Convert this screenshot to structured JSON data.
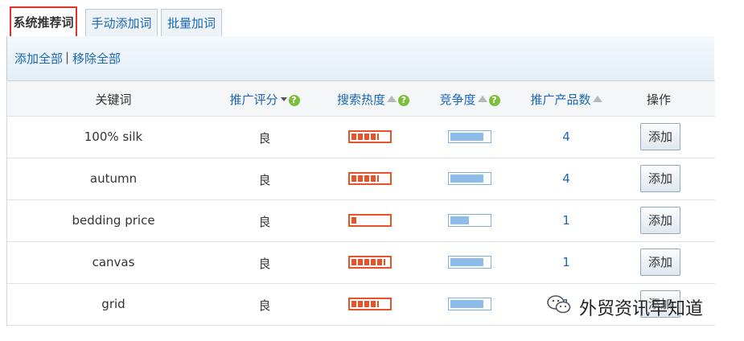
{
  "tabs": [
    {
      "label": "系统推荐词",
      "active": true
    },
    {
      "label": "手动添加词",
      "active": false
    },
    {
      "label": "批量加词",
      "active": false
    }
  ],
  "actions": {
    "add_all": "添加全部",
    "separator": "|",
    "remove_all": "移除全部"
  },
  "table": {
    "headers": {
      "keyword": "关键词",
      "score": "推广评分",
      "heat": "搜索热度",
      "competition": "竞争度",
      "products": "推广产品数",
      "operation": "操作"
    },
    "rows": [
      {
        "keyword": "100% silk",
        "score": "良",
        "heat": 0.8,
        "competition": 0.9,
        "products": "4",
        "action": "添加"
      },
      {
        "keyword": "autumn",
        "score": "良",
        "heat": 0.8,
        "competition": 0.9,
        "products": "4",
        "action": "添加"
      },
      {
        "keyword": "bedding price",
        "score": "良",
        "heat": 0.15,
        "competition": 0.5,
        "products": "1",
        "action": "添加"
      },
      {
        "keyword": "canvas",
        "score": "良",
        "heat": 1.0,
        "competition": 0.9,
        "products": "1",
        "action": "添加"
      },
      {
        "keyword": "grid",
        "score": "良",
        "heat": 0.8,
        "competition": 0.9,
        "products": "1",
        "action": "添加"
      }
    ]
  },
  "icons": {
    "help": "question-icon",
    "sort": "sort-up-icon",
    "dropdown": "dropdown-arrow-icon",
    "watermark": "wechat-icon"
  },
  "colors": {
    "tab_active_border": "#e0312b",
    "link": "#1b67b3",
    "heat_bar": "#e8542a",
    "competition_bar": "#8bbcea",
    "help_icon": "#7bbf3a"
  },
  "watermark": {
    "text": "外贸资讯早知道"
  }
}
